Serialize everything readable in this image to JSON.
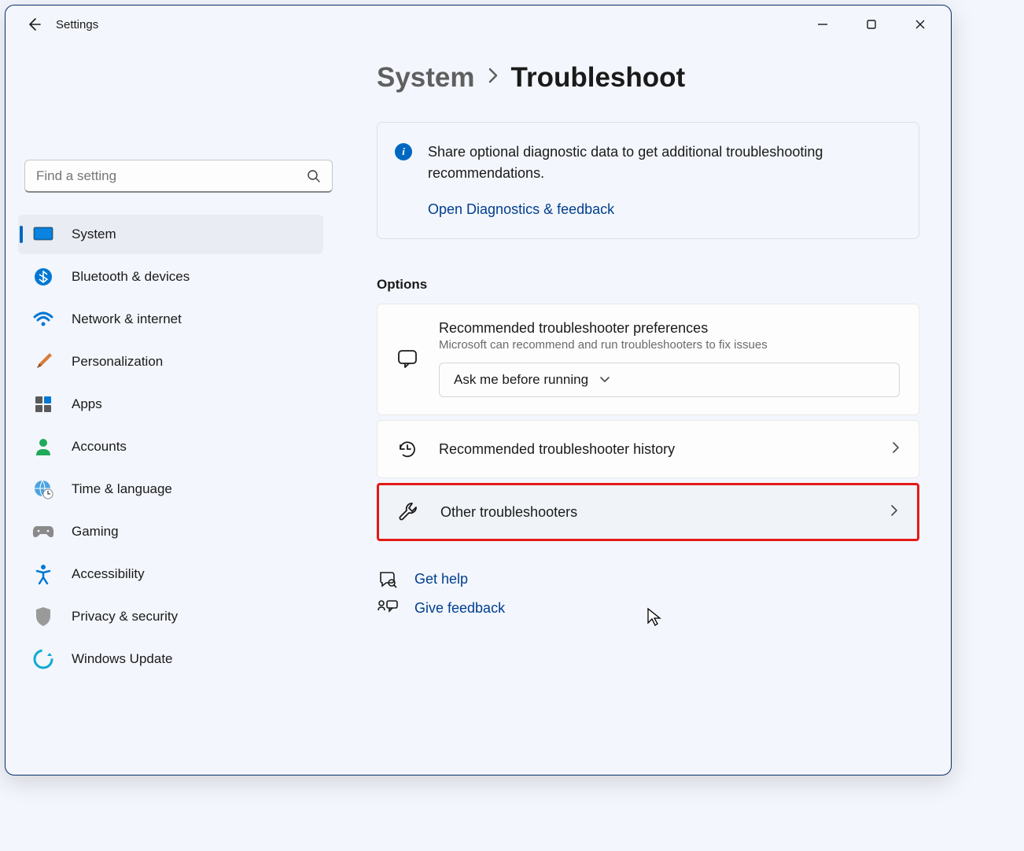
{
  "window": {
    "title": "Settings"
  },
  "breadcrumb": {
    "parent": "System",
    "current": "Troubleshoot"
  },
  "search": {
    "placeholder": "Find a setting"
  },
  "sidebar": {
    "items": [
      {
        "label": "System",
        "active": true
      },
      {
        "label": "Bluetooth & devices"
      },
      {
        "label": "Network & internet"
      },
      {
        "label": "Personalization"
      },
      {
        "label": "Apps"
      },
      {
        "label": "Accounts"
      },
      {
        "label": "Time & language"
      },
      {
        "label": "Gaming"
      },
      {
        "label": "Accessibility"
      },
      {
        "label": "Privacy & security"
      },
      {
        "label": "Windows Update"
      }
    ]
  },
  "infoCard": {
    "text": "Share optional diagnostic data to get additional troubleshooting recommendations.",
    "link": "Open Diagnostics & feedback"
  },
  "options": {
    "title": "Options",
    "pref": {
      "title": "Recommended troubleshooter preferences",
      "sub": "Microsoft can recommend and run troubleshooters to fix issues",
      "dropdownValue": "Ask me before running"
    },
    "history": {
      "title": "Recommended troubleshooter history"
    },
    "other": {
      "title": "Other troubleshooters"
    }
  },
  "footer": {
    "help": "Get help",
    "feedback": "Give feedback"
  }
}
